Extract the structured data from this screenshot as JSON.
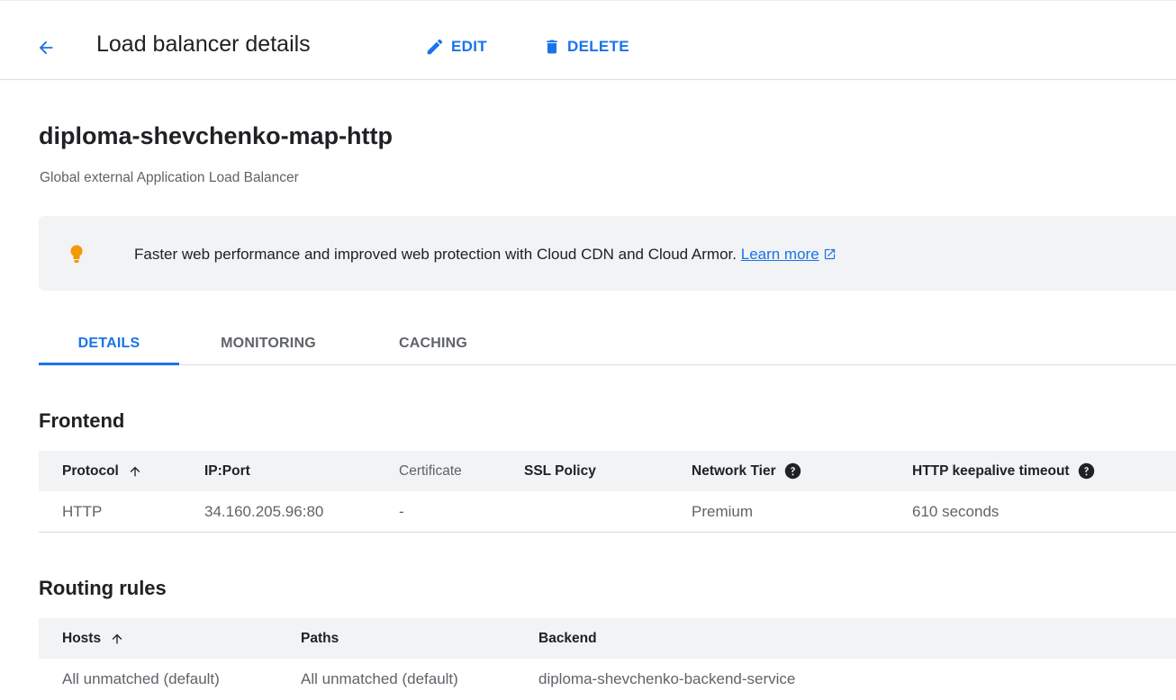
{
  "header": {
    "title": "Load balancer details",
    "back_icon": "arrow-back-icon",
    "edit_label": "EDIT",
    "delete_label": "DELETE"
  },
  "load_balancer": {
    "name": "diploma-shevchenko-map-http",
    "type": "Global external Application Load Balancer"
  },
  "banner": {
    "icon": "lightbulb-icon",
    "text": "Faster web performance and improved web protection with Cloud CDN and Cloud Armor.",
    "link_label": "Learn more"
  },
  "tabs": [
    {
      "label": "DETAILS",
      "active": true
    },
    {
      "label": "MONITORING",
      "active": false
    },
    {
      "label": "CACHING",
      "active": false
    }
  ],
  "frontend": {
    "title": "Frontend",
    "columns": [
      "Protocol",
      "IP:Port",
      "Certificate",
      "SSL Policy",
      "Network Tier",
      "HTTP keepalive timeout"
    ],
    "rows": [
      {
        "protocol": "HTTP",
        "ip_port": "34.160.205.96:80",
        "certificate": "-",
        "ssl_policy": "",
        "network_tier": "Premium",
        "keepalive": "610 seconds"
      }
    ]
  },
  "routing": {
    "title": "Routing rules",
    "columns": [
      "Hosts",
      "Paths",
      "Backend"
    ],
    "rows": [
      {
        "hosts": "All unmatched (default)",
        "paths": "All unmatched (default)",
        "backend": "diploma-shevchenko-backend-service"
      }
    ]
  },
  "colors": {
    "accent": "#1a73e8",
    "banner_bg": "#f1f3f4",
    "bulb": "#f29900",
    "muted_text": "#5f6368"
  }
}
